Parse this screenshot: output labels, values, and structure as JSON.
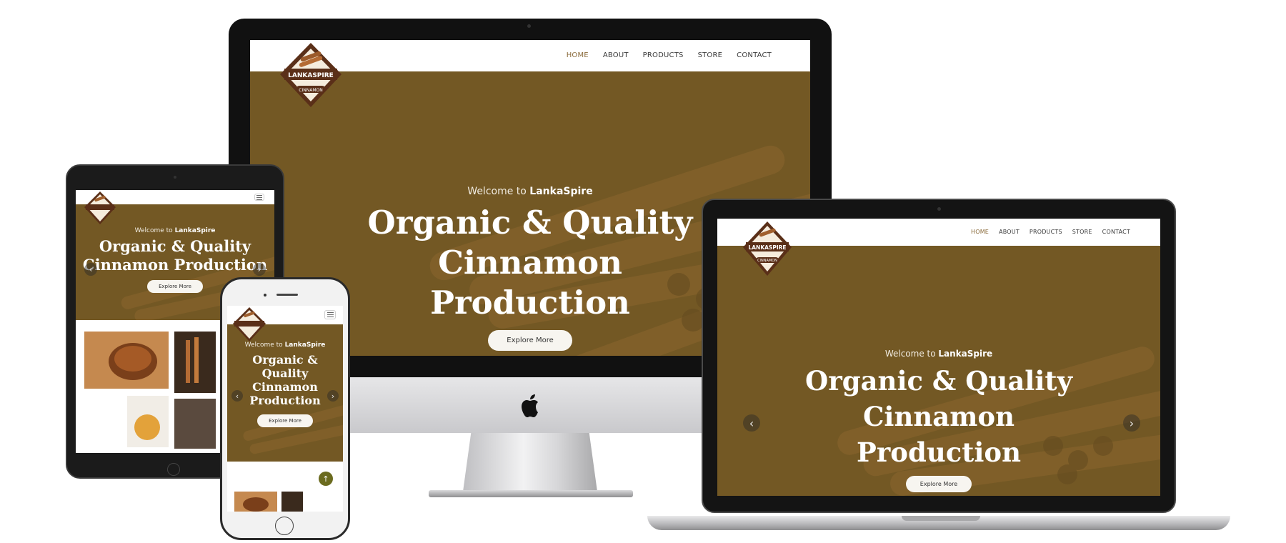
{
  "brand": {
    "name": "LANKASPIRE",
    "sub": "CINNAMON"
  },
  "nav": {
    "items": [
      "HOME",
      "ABOUT",
      "PRODUCTS",
      "STORE",
      "CONTACT"
    ],
    "active": "HOME"
  },
  "hero": {
    "welcome_prefix": "Welcome to",
    "welcome_brand": "LankaSpire",
    "headline_line1": "Organic & Quality",
    "headline_line2": "Cinnamon",
    "headline_line3": "Production",
    "cta_label": "Explore More"
  },
  "icons": {
    "prev": "chevron-left-icon",
    "next": "chevron-right-icon",
    "menu": "hamburger-menu-icon",
    "scroll_top": "arrow-up-icon",
    "apple": "apple-logo-icon"
  },
  "glyphs": {
    "prev": "‹",
    "next": "›",
    "up": "↑"
  },
  "colors": {
    "hero_overlay": "#6e5524",
    "nav_active": "#8a6a3a",
    "cta_bg": "#f7f5f0",
    "scroll_top_bg": "#6b6b1f"
  }
}
